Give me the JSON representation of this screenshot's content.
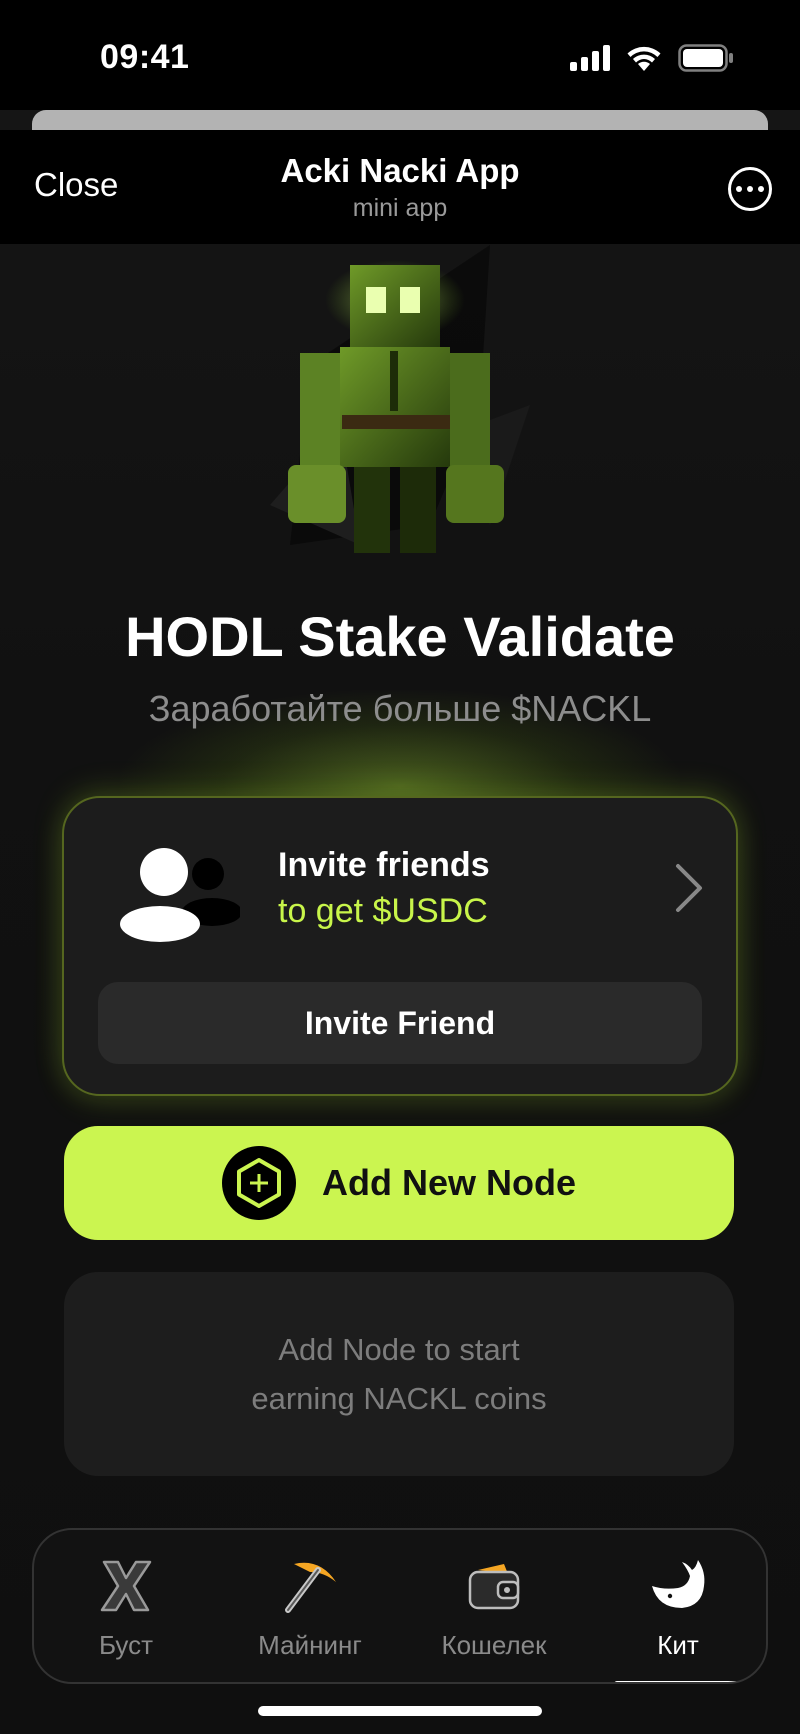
{
  "status_bar": {
    "time": "09:41"
  },
  "header": {
    "close_label": "Close",
    "title": "Acki Nacki App",
    "subtitle": "mini app"
  },
  "hero": {
    "title": "HODL Stake Validate",
    "subtitle": "Заработайте больше $NACKL"
  },
  "invite_card": {
    "title": "Invite friends",
    "subtitle": "to get $USDC",
    "button_label": "Invite Friend"
  },
  "add_node": {
    "label": "Add New Node"
  },
  "empty_state": {
    "text": "Add Node to start earning NACKL coins"
  },
  "tabs": [
    {
      "label": "Буст",
      "icon": "x-boost-icon"
    },
    {
      "label": "Майнинг",
      "icon": "pickaxe-icon"
    },
    {
      "label": "Кошелек",
      "icon": "wallet-icon"
    },
    {
      "label": "Кит",
      "icon": "whale-icon",
      "active": true
    }
  ],
  "colors": {
    "accent": "#cbf550",
    "background": "#111111",
    "card": "#1c1c1c"
  }
}
